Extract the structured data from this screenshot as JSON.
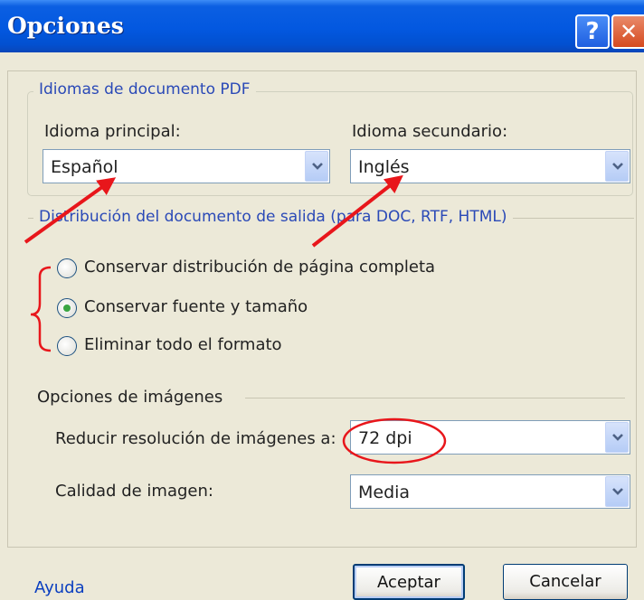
{
  "dialog": {
    "title": "Opciones",
    "help_button_glyph": "?",
    "close_button_glyph": "✕"
  },
  "pdf_languages": {
    "legend": "Idiomas de documento PDF",
    "primary_label": "Idioma principal:",
    "primary_value": "Español",
    "secondary_label": "Idioma secundario:",
    "secondary_value": "Inglés"
  },
  "layout": {
    "legend": "Distribución del documento de salida (para DOC, RTF, HTML)",
    "options": [
      {
        "label": "Conservar distribución de página completa",
        "selected": false
      },
      {
        "label": "Conservar fuente y tamaño",
        "selected": true
      },
      {
        "label": "Eliminar todo el formato",
        "selected": false
      }
    ]
  },
  "images": {
    "legend": "Opciones de imágenes",
    "resolution_label": "Reducir resolución de imágenes a:",
    "resolution_value": "72 dpi",
    "quality_label": "Calidad de imagen:",
    "quality_value": "Media"
  },
  "footer": {
    "help_link": "Ayuda",
    "ok_button": "Aceptar",
    "cancel_button": "Cancelar"
  },
  "colors": {
    "annotation": "#e8161b",
    "legend_text": "#2a49b7",
    "titlebar": "#0358e0"
  }
}
